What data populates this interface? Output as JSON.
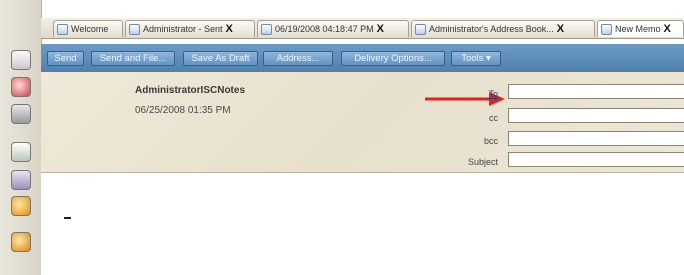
{
  "tabs": [
    {
      "label": "Welcome",
      "close": ""
    },
    {
      "label": "Administrator - Sent",
      "close": "X"
    },
    {
      "label": "06/19/2008 04:18:47 PM",
      "close": "X"
    },
    {
      "label": "Administrator's Address Book...",
      "close": "X"
    },
    {
      "label": "New Memo",
      "close": "X"
    }
  ],
  "toolbar": {
    "send": "Send",
    "send_and_file": "Send and File...",
    "save_as_draft": "Save As Draft",
    "address": "Address...",
    "delivery_options": "Delivery Options...",
    "tools": "Tools ▾"
  },
  "header": {
    "sender": "AdministratorISCNotes",
    "date": "06/25/2008 01:35 PM",
    "fields": {
      "to_label": "To",
      "cc_label": "cc",
      "bcc_label": "bcc",
      "subject_label": "Subject",
      "to_value": "",
      "cc_value": "",
      "bcc_value": "",
      "subject_value": ""
    }
  },
  "colors": {
    "toolbar": "#5b8cba",
    "header_bg": "#ebe5d4",
    "arrow": "#e2231a"
  },
  "icons": [
    "mail-icon",
    "calendar-icon",
    "address-book-icon",
    "todo-icon",
    "replicator-icon",
    "schedule-icon",
    "database-icon"
  ]
}
